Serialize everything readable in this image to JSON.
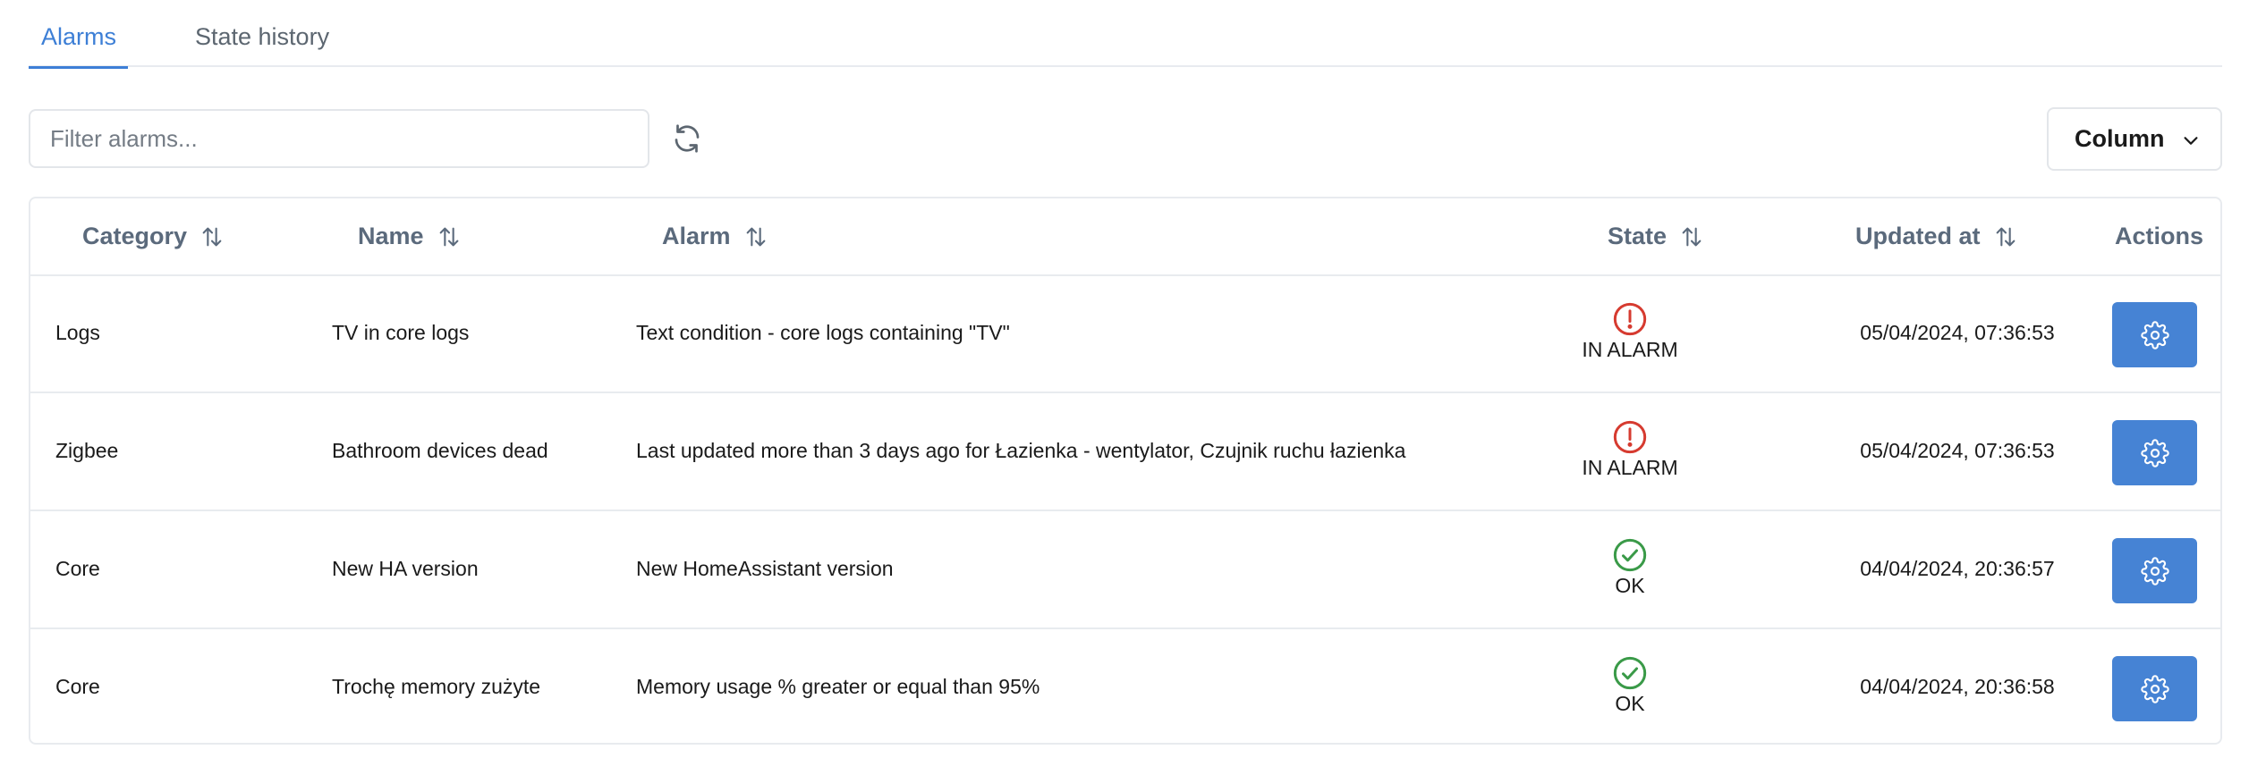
{
  "tabs": [
    {
      "label": "Alarms",
      "active": true
    },
    {
      "label": "State history",
      "active": false
    }
  ],
  "toolbar": {
    "filter_placeholder": "Filter alarms...",
    "filter_value": "",
    "refresh_icon": "refresh-icon",
    "column_label": "Column",
    "column_icon": "chevron-down-icon"
  },
  "table": {
    "headers": {
      "category": "Category",
      "name": "Name",
      "alarm": "Alarm",
      "state": "State",
      "updated": "Updated at",
      "actions": "Actions"
    },
    "rows": [
      {
        "category": "Logs",
        "name": "TV in core logs",
        "alarm": "Text condition - core logs containing \"TV\"",
        "state": "IN ALARM",
        "state_icon": "alert-circle-icon",
        "updated": "05/04/2024, 07:36:53"
      },
      {
        "category": "Zigbee",
        "name": "Bathroom devices dead",
        "alarm": "Last updated more than 3 days ago for Łazienka - wentylator, Czujnik ruchu łazienka",
        "state": "IN ALARM",
        "state_icon": "alert-circle-icon",
        "updated": "05/04/2024, 07:36:53"
      },
      {
        "category": "Core",
        "name": "New HA version",
        "alarm": "New HomeAssistant version",
        "state": "OK",
        "state_icon": "check-circle-icon",
        "updated": "04/04/2024, 20:36:57"
      },
      {
        "category": "Core",
        "name": "Trochę memory zużyte",
        "alarm": "Memory usage % greater or equal than 95%",
        "state": "OK",
        "state_icon": "check-circle-icon",
        "updated": "04/04/2024, 20:36:58"
      }
    ]
  },
  "colors": {
    "accent": "#3d7fd6",
    "action_button": "#4683d4",
    "alarm_red": "#d63b30",
    "ok_green": "#3a9a48",
    "header_text": "#5b6a7c",
    "border": "#e8ebef"
  }
}
